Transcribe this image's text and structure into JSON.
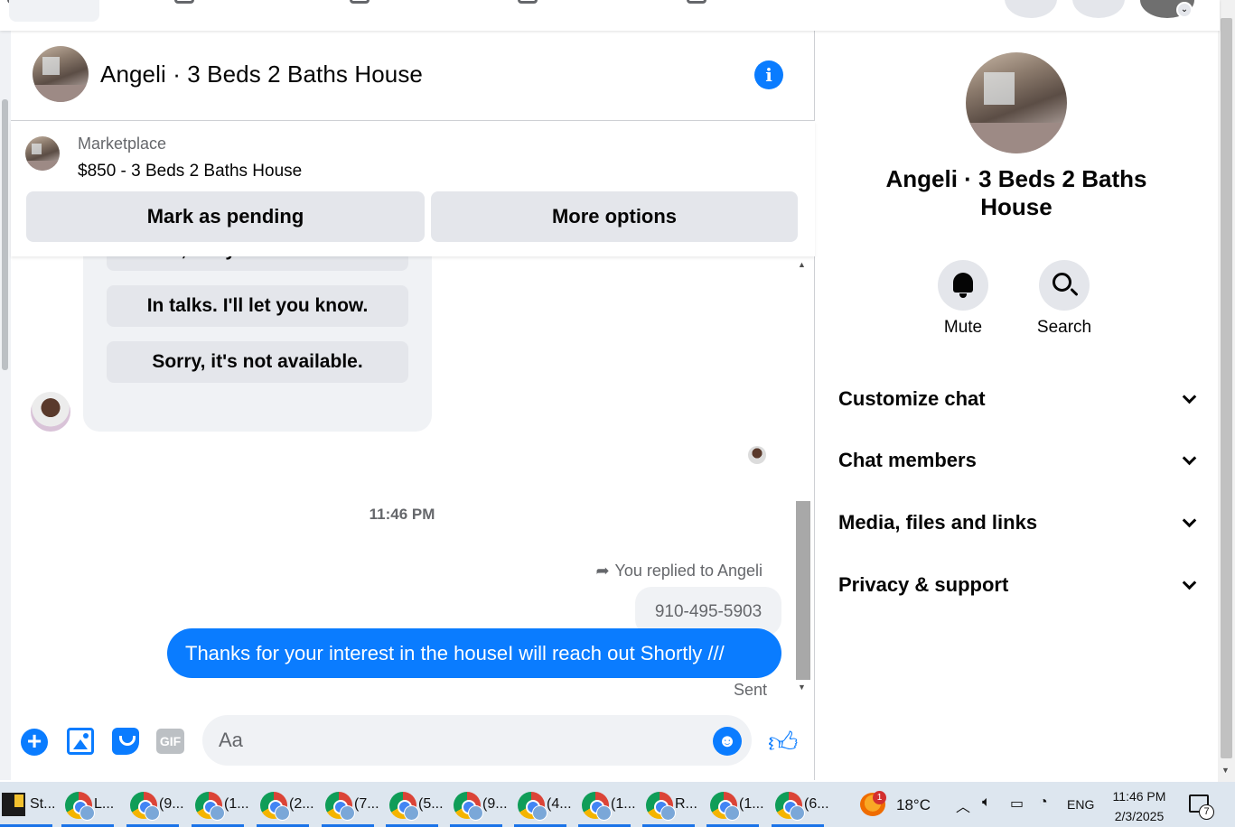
{
  "chat": {
    "title": "Angeli · 3 Beds 2 Baths House",
    "marketplace": {
      "source": "Marketplace",
      "listing": "$850 - 3 Beds 2 Baths House",
      "mark_pending": "Mark as pending",
      "more_options": "More options"
    },
    "quick_replies": [
      "Yes, are you interested?",
      "In talks. I'll let you know.",
      "Sorry, it's not available."
    ],
    "timestamp": "11:46 PM",
    "replied_to": "You replied to Angeli",
    "quoted_text": "910-495-5903",
    "sent_message": "Thanks for your interest in the houseI will reach out Shortly ///",
    "sent_status": "Sent",
    "composer": {
      "placeholder": "Aa",
      "gif_label": "GIF"
    }
  },
  "info_panel": {
    "title": "Angeli · 3 Beds 2 Baths House",
    "actions": {
      "mute": "Mute",
      "search": "Search"
    },
    "rows": [
      "Customize chat",
      "Chat members",
      "Media, files and links",
      "Privacy & support"
    ]
  },
  "taskbar": {
    "apps": [
      {
        "label": "St..."
      },
      {
        "label": "L..."
      },
      {
        "label": "(9..."
      },
      {
        "label": "(1..."
      },
      {
        "label": "(2..."
      },
      {
        "label": "(7..."
      },
      {
        "label": "(5..."
      },
      {
        "label": "(9..."
      },
      {
        "label": "(4..."
      },
      {
        "label": "(1..."
      },
      {
        "label": "R..."
      },
      {
        "label": "(1..."
      },
      {
        "label": "(6..."
      }
    ],
    "weather_badge": "1",
    "temperature": "18°C",
    "language": "ENG",
    "time": "11:46 PM",
    "date": "2/3/2025",
    "notification_count": "7"
  },
  "colors": {
    "accent": "#0a7cff",
    "secondary_bg": "#e4e6eb",
    "muted_text": "#65676b"
  }
}
